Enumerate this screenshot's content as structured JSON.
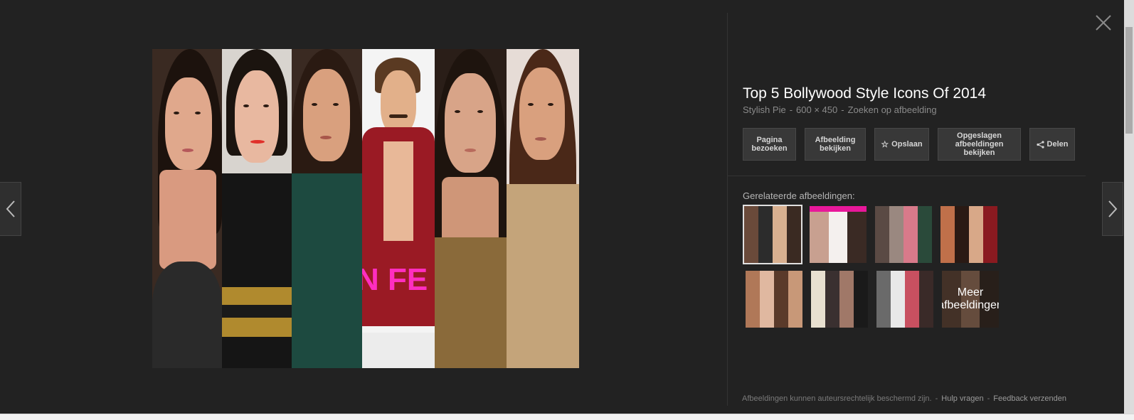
{
  "image": {
    "title": "Top 5 Bollywood Style Icons Of 2014",
    "source": "Stylish Pie",
    "dimensions": "600 × 450",
    "search_by_image": "Zoeken op afbeelding",
    "overlay_text": "N FE"
  },
  "actions": {
    "visit_page": "Pagina bezoeken",
    "view_image": "Afbeelding bekijken",
    "save": "Opslaan",
    "view_saved": "Opgeslagen afbeeldingen bekijken",
    "share": "Delen"
  },
  "related": {
    "label": "Gerelateerde afbeeldingen:",
    "more_label": "Meer afbeeldingen"
  },
  "footer": {
    "copyright_note": "Afbeeldingen kunnen auteursrechtelijk beschermd zijn.",
    "help": "Hulp vragen",
    "feedback": "Feedback verzenden"
  },
  "icons": {
    "prev": "chevron-left-icon",
    "next": "chevron-right-icon",
    "close": "close-icon",
    "save": "star-icon",
    "share": "share-icon"
  },
  "colors": {
    "background": "#222222",
    "button_bg": "#383838",
    "title": "#ffffff",
    "meta": "#8a8a8a"
  }
}
